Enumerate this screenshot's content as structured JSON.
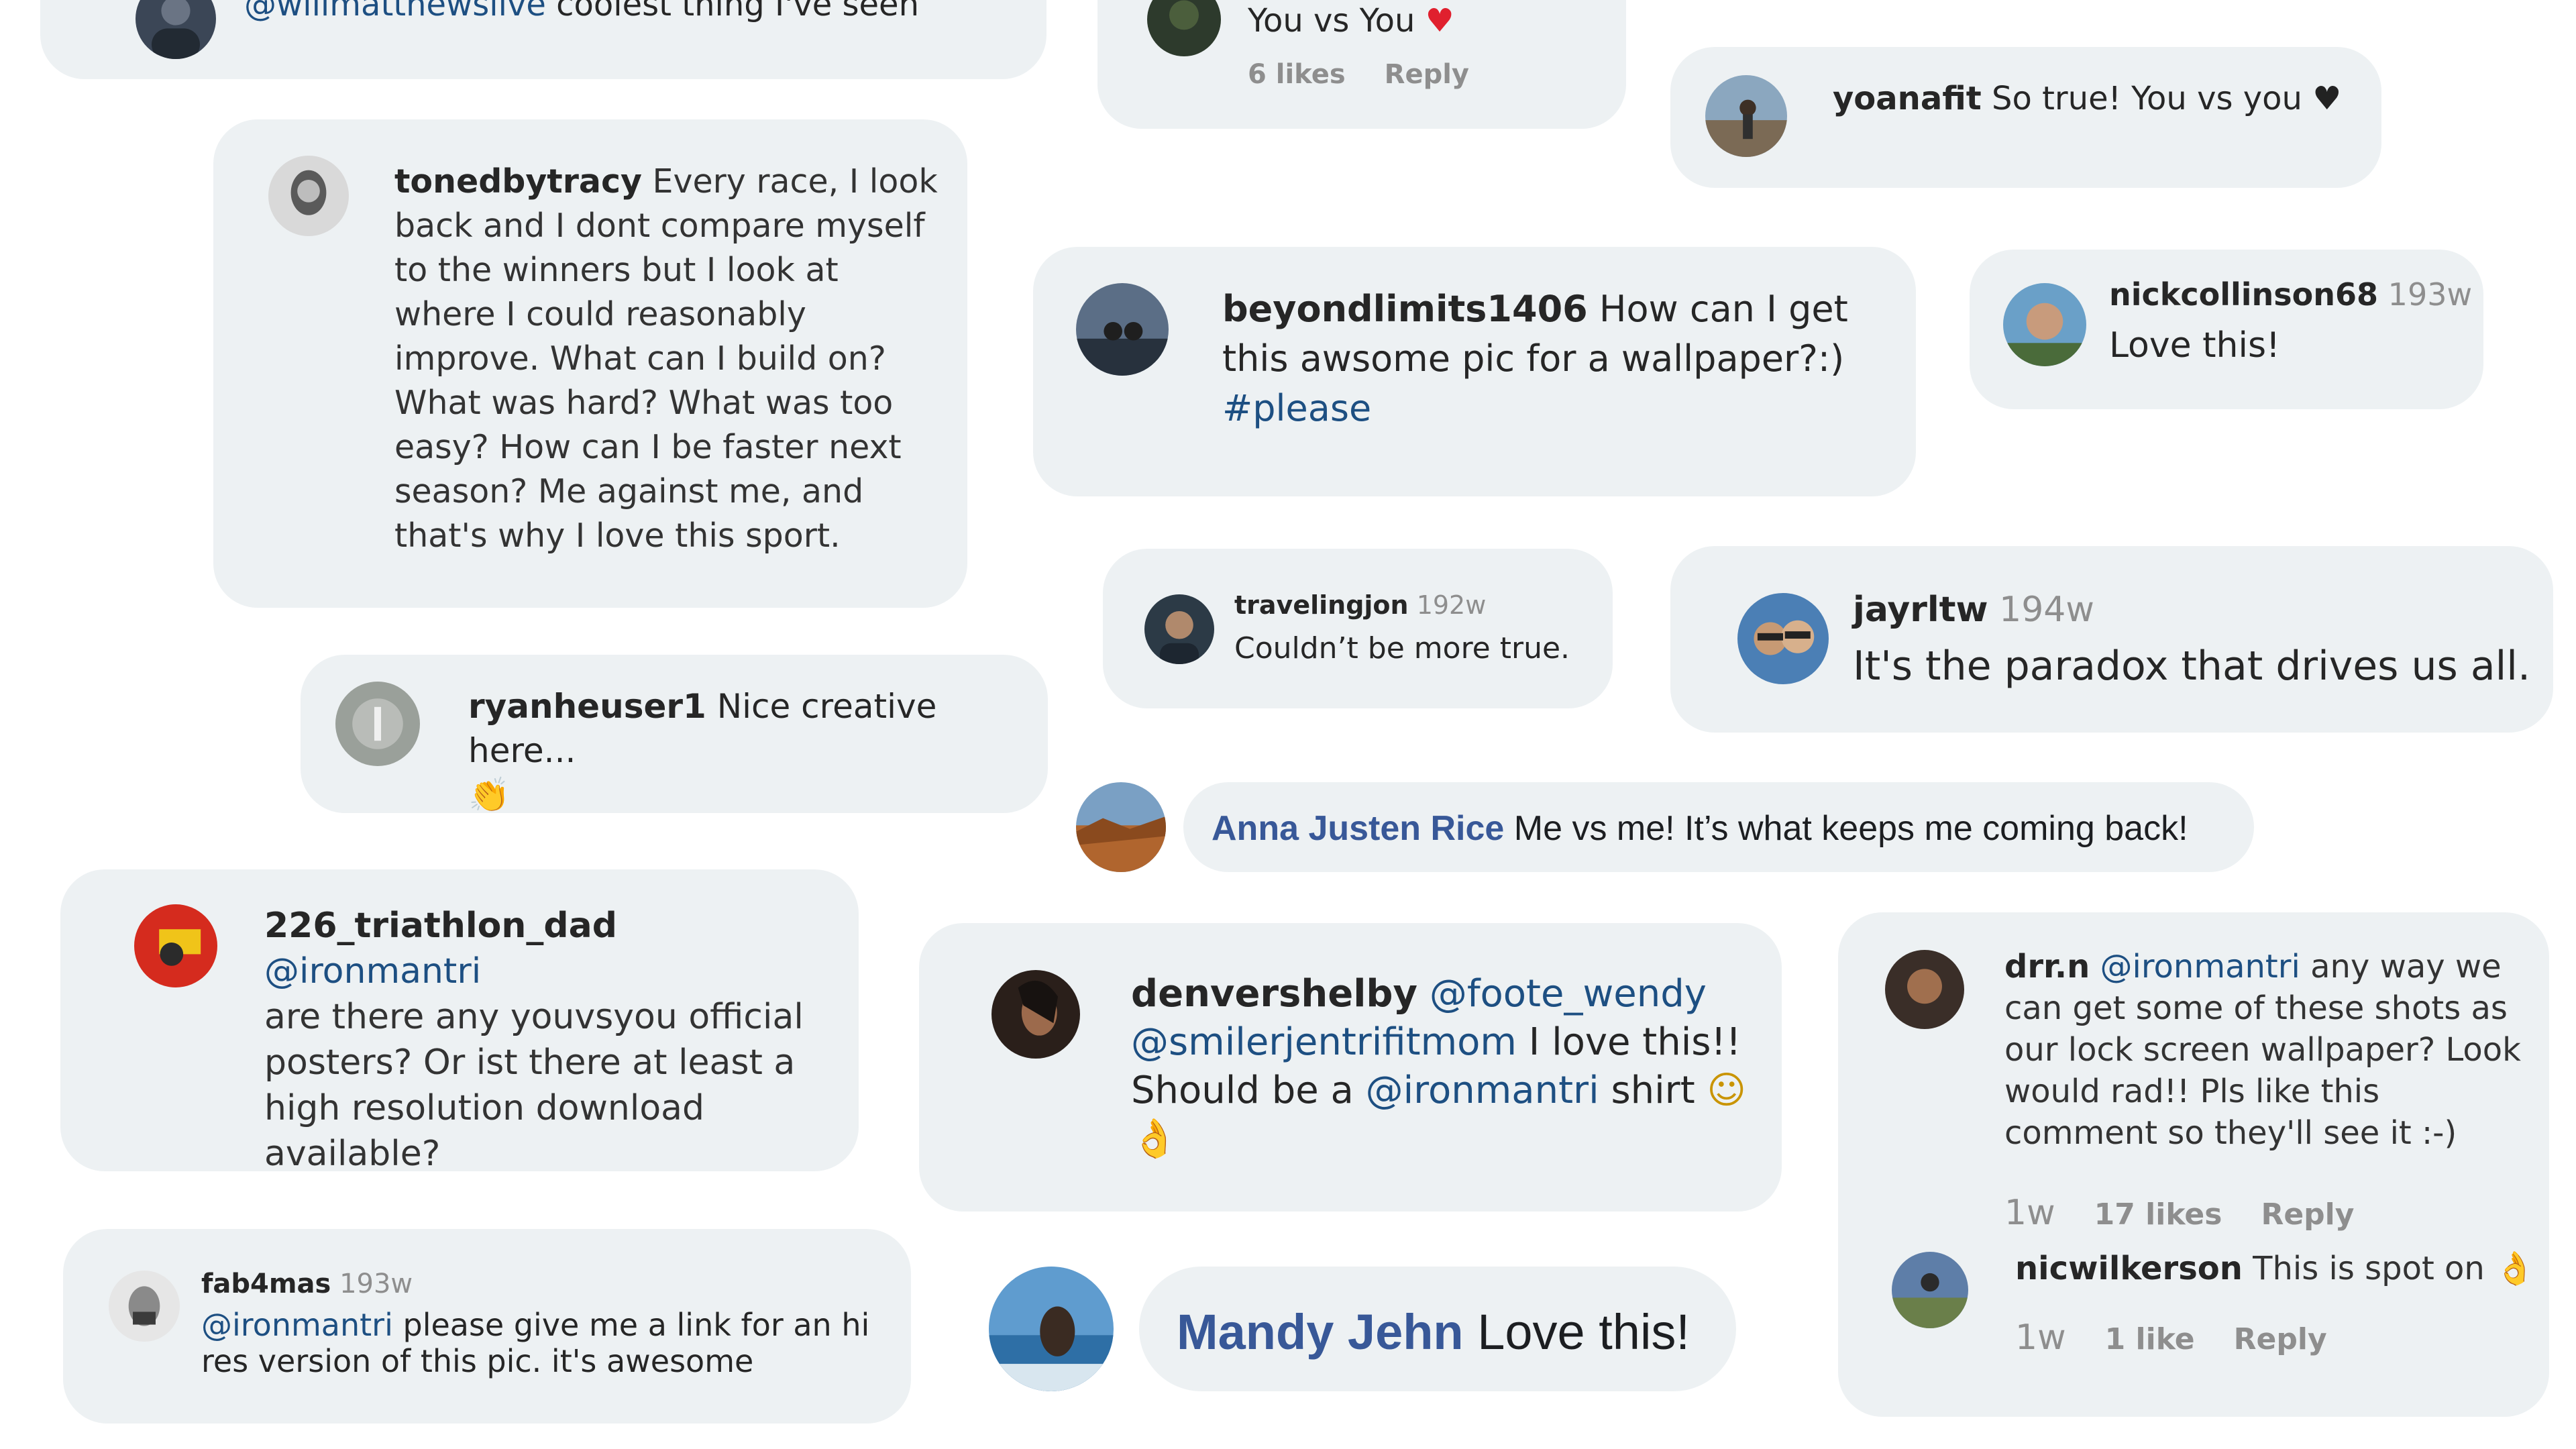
{
  "comments": {
    "willmatthews": {
      "mention": "@willmatthewslive",
      "text": " coolest thing I've seen"
    },
    "youvsyou": {
      "text": "You vs You",
      "emoji": "♥",
      "likes": "6 likes",
      "reply": "Reply"
    },
    "yoanafit": {
      "user": "yoanafit",
      "text": " So true! You vs you",
      "emoji": "♥"
    },
    "tonedbytracy": {
      "user": "tonedbytracy",
      "text": " Every race, I look back and I dont compare myself to the winners but I look at where I could reasonably improve. What can I build on? What was hard? What was too easy? How can I be faster next season? Me against me, and that's why I love this sport."
    },
    "beyondlimits": {
      "user": "beyondlimits1406",
      "text": " How can I get this awsome pic for a wallpaper?:) ",
      "hashtag": "#please"
    },
    "nickcollinson": {
      "user": "nickcollinson68",
      "time": "193w",
      "text": "Love this!"
    },
    "travelingjon": {
      "user": "travelingjon",
      "time": "192w",
      "text": "Couldn’t be more true."
    },
    "jayrltw": {
      "user": "jayrltw",
      "time": "194w",
      "text": "It's the paradox that drives us all."
    },
    "ryanheuser": {
      "user": "ryanheuser1",
      "text": " Nice creative here...",
      "emoji": "👏"
    },
    "annajusten": {
      "user": "Anna Justen Rice",
      "text": " Me vs me! It’s what keeps me coming back!"
    },
    "triathlondad": {
      "user": "226_triathlon_dad",
      "mention": "@ironmantri",
      "text": "are there any youvsyou official posters? Or ist there at least a high resolution download available?"
    },
    "denvershelby": {
      "user": "denvershelby",
      "mention1": "@foote_wendy",
      "mention2": "@smilerjentrifitmom",
      "text1": " I love this!! Should be a ",
      "mention3": "@ironmantri",
      "text2": " shirt ",
      "emoji1": "☺",
      "emoji2": "👌"
    },
    "drrn": {
      "user": "drr.n",
      "mention": "@ironmantri",
      "text": " any way we can get some of these shots as our lock screen wallpaper? Look would rad!! Pls like this comment so they'll see it :-)",
      "time": "1w",
      "likes": "17 likes",
      "reply": "Reply"
    },
    "nicwilkerson": {
      "user": "nicwilkerson",
      "text": " This is spot on ",
      "emoji": "👌",
      "time": "1w",
      "likes": "1 like",
      "reply": "Reply"
    },
    "fab4mas": {
      "user": "fab4mas",
      "time": "193w",
      "mention": "@ironmantri",
      "text": " please give me a link for an hi res version of this pic. it's awesome"
    },
    "mandyjehn": {
      "user": "Mandy Jehn",
      "text": " Love this!"
    }
  }
}
